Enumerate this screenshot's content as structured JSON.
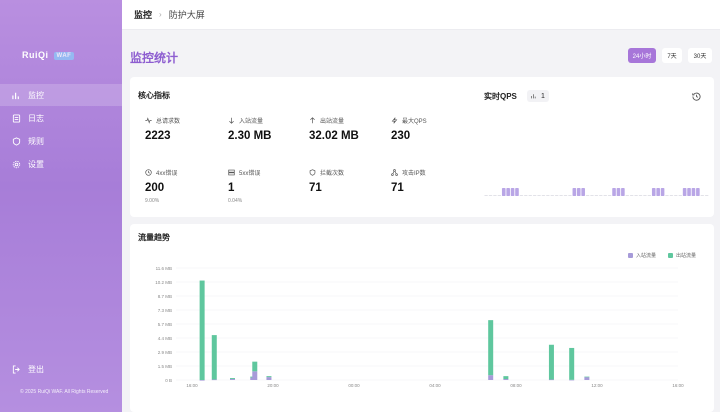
{
  "brand": {
    "name": "RuiQi",
    "tag": "WAF"
  },
  "sidebar": {
    "items": [
      {
        "label": "监控",
        "icon": "chart-bar-icon"
      },
      {
        "label": "日志",
        "icon": "document-icon"
      },
      {
        "label": "规则",
        "icon": "shield-icon"
      },
      {
        "label": "设置",
        "icon": "gear-icon"
      }
    ],
    "logout_label": "登出",
    "copyright": "© 2025 RuiQi WAF. All Rights Reserved"
  },
  "breadcrumb": {
    "root": "监控",
    "current": "防护大屏"
  },
  "page": {
    "title": "监控统计"
  },
  "time_ranges": [
    "24小时",
    "7天",
    "30天"
  ],
  "metrics": {
    "title": "核心指标",
    "items": [
      {
        "label": "总请求数",
        "value": "2223",
        "icon": "activity-icon"
      },
      {
        "label": "入站流量",
        "value": "2.30 MB",
        "icon": "arrow-down-icon"
      },
      {
        "label": "出站流量",
        "value": "32.02 MB",
        "icon": "arrow-up-icon"
      },
      {
        "label": "最大QPS",
        "value": "230",
        "icon": "bolt-icon"
      },
      {
        "label": "4xx错误",
        "value": "200",
        "sub": "9.00%",
        "icon": "clock-icon"
      },
      {
        "label": "5xx错误",
        "value": "1",
        "sub": "0.04%",
        "icon": "server-icon"
      },
      {
        "label": "拦截次数",
        "value": "71",
        "icon": "shield-icon"
      },
      {
        "label": "攻击IP数",
        "value": "71",
        "icon": "network-icon"
      }
    ]
  },
  "qps": {
    "title": "实时QPS",
    "value": "1"
  },
  "traffic": {
    "title": "流量趋势",
    "legend": [
      {
        "name": "入站流量",
        "color": "#a79bd9"
      },
      {
        "name": "出站流量",
        "color": "#5fc79e"
      }
    ]
  },
  "chart_data": {
    "type": "bar",
    "stacked": true,
    "yticks": [
      "0 B",
      "1.5 MB",
      "2.9 MB",
      "4.4 MB",
      "5.7 MB",
      "7.3 MB",
      "8.7 MB",
      "10.2 MB",
      "11.6 MB"
    ],
    "xticks": [
      "16:00",
      "20:00",
      "00:00",
      "04:00",
      "08:00",
      "12:00",
      "16:00"
    ],
    "ylim": [
      0,
      11.6
    ],
    "series": [
      {
        "name": "入站流量",
        "values": [
          [
            0.05,
            0.0
          ],
          [
            0.05,
            0.05
          ],
          [
            0.05,
            0.1
          ],
          [
            0.1,
            0.25
          ],
          [
            0.15,
            0.9
          ],
          [
            0.05,
            0.3
          ],
          [
            0.1,
            0.5
          ],
          [
            0.1,
            0.1
          ],
          [
            0.05,
            0.05
          ],
          [
            0.05,
            0.02
          ],
          [
            0.05,
            0.3
          ]
        ]
      },
      {
        "name": "出站流量",
        "values": [
          [
            0.05,
            10.3
          ],
          [
            0.05,
            4.6
          ],
          [
            0.05,
            0.1
          ],
          [
            0.1,
            0.1
          ],
          [
            0.15,
            1.0
          ],
          [
            0.05,
            0.1
          ],
          [
            0.1,
            5.7
          ],
          [
            0.1,
            0.3
          ],
          [
            0.05,
            3.6
          ],
          [
            0.05,
            3.3
          ],
          [
            0.05,
            0.05
          ]
        ]
      }
    ],
    "bar_positions_hours": [
      1.0,
      2.2,
      4.0,
      6.0,
      6.2,
      7.6,
      29.5,
      31.0,
      35.5,
      37.5,
      39.0
    ]
  }
}
